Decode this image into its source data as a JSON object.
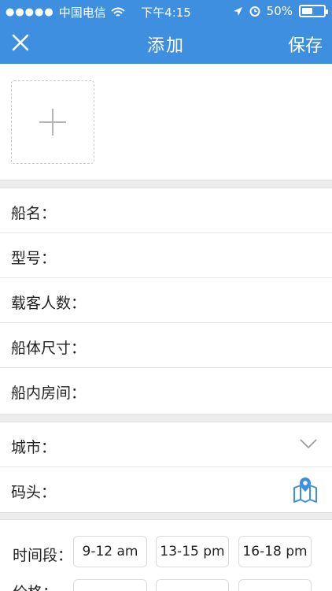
{
  "status_bar": {
    "signal_dots": "●●●●●",
    "carrier": "中国电信",
    "time": "下午4:15",
    "battery_percent": "50%",
    "battery_level": 0.5
  },
  "nav": {
    "title": "添加",
    "save_label": "保存",
    "close_icon": "close-icon"
  },
  "photo": {
    "add_icon": "plus-icon"
  },
  "form_fields": {
    "boat_name": "船名：",
    "model": "型号：",
    "passengers": "载客人数：",
    "hull_size": "船体尺寸：",
    "cabins": "船内房间："
  },
  "location": {
    "city": "城市：",
    "pier": "码头："
  },
  "time": {
    "label": "时间段：",
    "slots": [
      "9-12 am",
      "13-15 pm",
      "16-18 pm"
    ]
  },
  "price": {
    "label": "价格："
  },
  "colors": {
    "primary": "#3e8fe0",
    "separator": "#ececec"
  }
}
